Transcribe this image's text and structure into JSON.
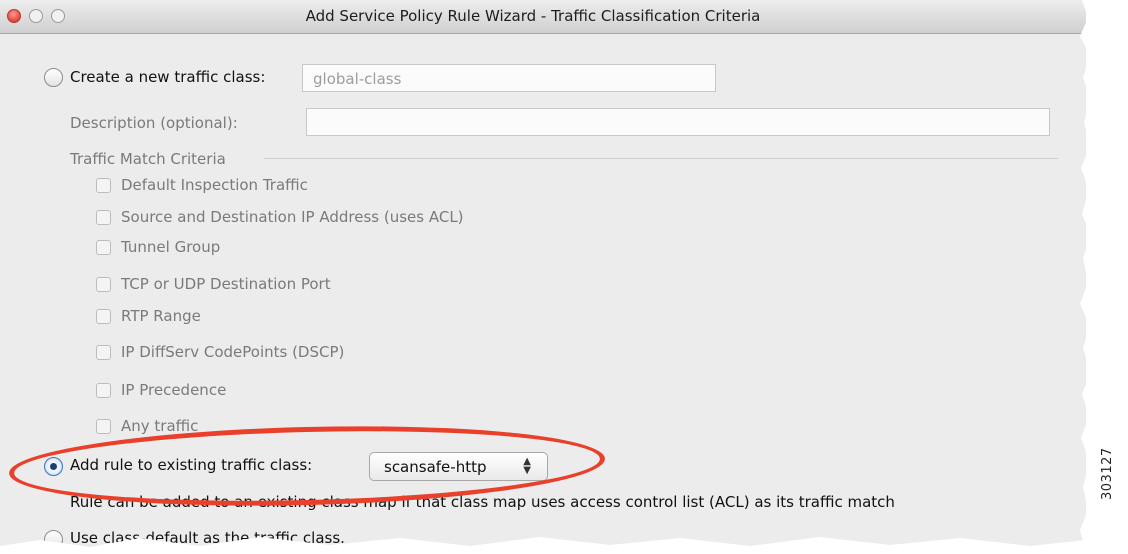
{
  "window": {
    "title": "Add Service Policy Rule Wizard - Traffic Classification Criteria"
  },
  "create_new_class": {
    "label": "Create a new traffic class:",
    "value": "global-class",
    "selected": false
  },
  "description": {
    "label": "Description (optional):",
    "value": ""
  },
  "traffic_match": {
    "group_label": "Traffic Match Criteria",
    "options": [
      {
        "label": "Default Inspection Traffic",
        "checked": false
      },
      {
        "label": "Source and Destination IP Address (uses ACL)",
        "checked": false
      },
      {
        "label": "Tunnel Group",
        "checked": false
      },
      {
        "label": "TCP or UDP Destination Port",
        "checked": false
      },
      {
        "label": "RTP Range",
        "checked": false
      },
      {
        "label": "IP DiffServ CodePoints (DSCP)",
        "checked": false
      },
      {
        "label": "IP Precedence",
        "checked": false
      },
      {
        "label": "Any traffic",
        "checked": false
      }
    ]
  },
  "existing_class": {
    "label": "Add rule to existing traffic class:",
    "selected": true,
    "select_value": "scansafe-http",
    "note": "Rule can be added to an existing class map if that class map uses access control list (ACL) as its traffic match"
  },
  "class_default": {
    "label": "Use class-default as the traffic class.",
    "selected": false
  },
  "figure_number": "303127",
  "colors": {
    "highlight": "#e8402a",
    "window_bg": "#ececec",
    "radio_selected": "#3d74c2"
  },
  "icons": {
    "close": "close-button-icon",
    "minimize": "minimize-button-icon",
    "zoom": "zoom-button-icon",
    "select_arrows": "up-down-arrows-icon"
  }
}
